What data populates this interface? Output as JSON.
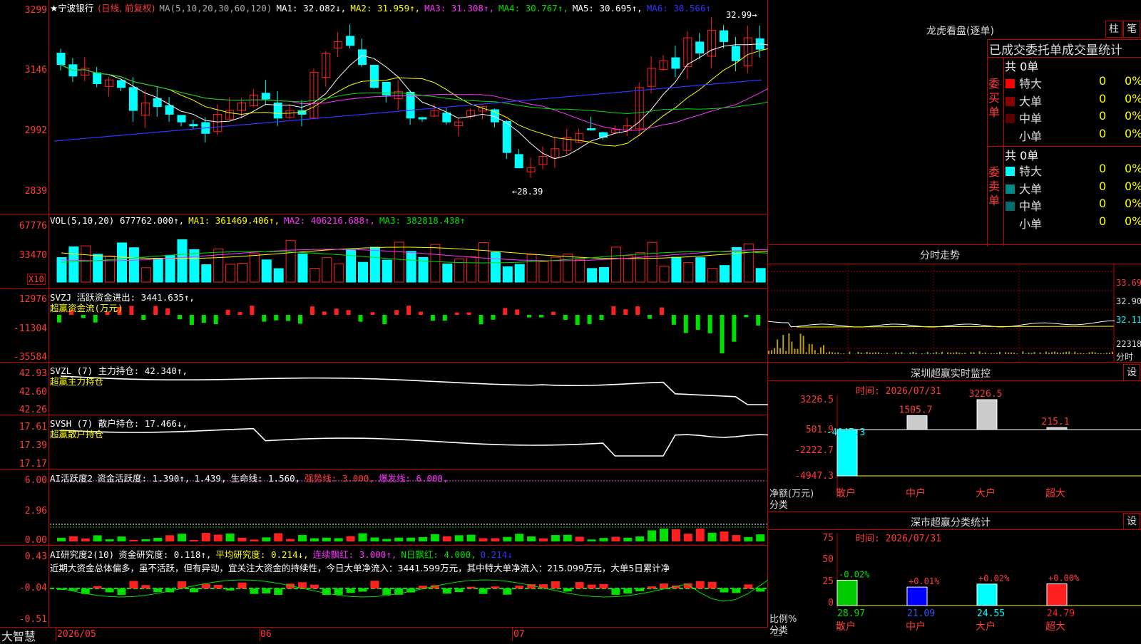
{
  "stock": {
    "name": "★宁波银行",
    "mode": "(日线, 前复权)",
    "ma_label": "MA(5,10,20,30,60,120)",
    "ma1": "MA1: 32.082↓,",
    "ma2": "MA2: 31.959↑,",
    "ma3": "MA3: 31.308↑,",
    "ma4": "MA4: 30.767↑,",
    "ma5": "MA5: 30.695↑,",
    "ma6": "MA6: 30.566↑",
    "price_axis": [
      "3299",
      "3146",
      "2992",
      "2839"
    ],
    "high_marker": "32.99→",
    "low_marker": "←28.39"
  },
  "vol": {
    "header": "VOL(5,10,20)  677762.000↑,",
    "ma1": "MA1: 361469.406↑,",
    "ma2": "MA2: 406216.688↑,",
    "ma3": "MA3: 382818.438↑",
    "axis": [
      "67776",
      "33470"
    ],
    "unit": "X10"
  },
  "svzj": {
    "header": "SVZJ  活跃资金进出: 3441.635↑,",
    "sub": "超赢资金流(万元)",
    "axis": [
      "12976",
      "-11304",
      "-35584"
    ]
  },
  "svzl": {
    "header": "SVZL (7) 主力持仓: 42.340↑,",
    "sub": "超赢主力持仓",
    "axis": [
      "42.93",
      "42.60",
      "42.26"
    ]
  },
  "svsh": {
    "header": "SVSH (7) 散户持仓: 17.466↓,",
    "sub": "超赢散户持仓",
    "axis": [
      "17.61",
      "17.39",
      "17.17"
    ]
  },
  "ai1": {
    "name": "AI活跃度2",
    "a": "资金活跃度: 1.390↑,",
    "b": "1.439,",
    "c": "生命线: 1.560,",
    "d": "强势线: 3.000,",
    "e": "爆发线: 6.000,",
    "axis": [
      "6.00",
      "2.96",
      "0.00"
    ]
  },
  "ai2": {
    "name": "AI研究度2(10)",
    "a": "资金研究度: 0.118↑,",
    "b": "平均研究度: 0.214↓,",
    "c": "连续飘红: 3.000↑,",
    "d": "N日飘红: 4.000,",
    "e": "0.214↓",
    "comment": "近期大资金总体偏多，虽不活跃，但有异动，宜关注大资金的持续性，今日大单净流入：3441.599万元，其中特大单净流入：215.099万元，大单5日累计净",
    "axis": [
      "0.43",
      "-0.04",
      "-0.51"
    ]
  },
  "dates": [
    "2026/05",
    "06",
    "07"
  ],
  "brand": "大智慧",
  "dragon": {
    "title": "龙虎看盘(逐单)",
    "btn1": "柱",
    "btn2": "笔",
    "heading": "已成交委托单成交量统计",
    "buy_label": "委买单",
    "sell_label": "委卖单",
    "buy_total": "共 0单",
    "sell_total": "共 0单",
    "buy_rows": [
      {
        "name": "特大",
        "n": "0",
        "pct": "0%",
        "color": "#ff0000"
      },
      {
        "name": "大单",
        "n": "0",
        "pct": "0%",
        "color": "#8a0000"
      },
      {
        "name": "中单",
        "n": "0",
        "pct": "0%",
        "color": "#5a0000"
      },
      {
        "name": "小单",
        "n": "0",
        "pct": "0%",
        "color": "#000000"
      }
    ],
    "sell_rows": [
      {
        "name": "特大",
        "n": "0",
        "pct": "0%",
        "color": "#00ffff"
      },
      {
        "name": "大单",
        "n": "0",
        "pct": "0%",
        "color": "#008b8b"
      },
      {
        "name": "中单",
        "n": "0",
        "pct": "0%",
        "color": "#006d6d"
      },
      {
        "name": "小单",
        "n": "0",
        "pct": "0%",
        "color": "#000000"
      }
    ]
  },
  "intraday": {
    "title": "分时走势",
    "axis": [
      "33.69",
      "32.90",
      "32.11",
      "22318"
    ],
    "unit": "分时"
  },
  "monitor": {
    "title": "深圳超赢实时监控",
    "btn": "设",
    "time": "时间: 2026/07/31",
    "axis": [
      "3226.5",
      "501.9",
      "-2222.7",
      "-4947.3"
    ],
    "xlabel1": "净额(万元)",
    "xlabel2": "分类",
    "categories": [
      "散户",
      "中户",
      "大户",
      "超大"
    ],
    "values": [
      -4947.3,
      1505.7,
      3226.5,
      215.1
    ],
    "value_labels": [
      "-4947.3",
      "1505.7",
      "3226.5",
      "215.1"
    ]
  },
  "classify": {
    "title": "深市超赢分类统计",
    "btn": "设",
    "time": "时间: 2026/07/31",
    "axis": [
      "75",
      "50",
      "25",
      "0"
    ],
    "xlabel1": "比例%",
    "xlabel2": "分类",
    "categories": [
      "散户",
      "中户",
      "大户",
      "超大"
    ],
    "values": [
      28.97,
      21.09,
      24.55,
      24.79
    ],
    "value_labels": [
      "28.97",
      "21.09",
      "24.55",
      "24.79"
    ],
    "changes": [
      "-0.02%",
      "+0.01%",
      "+0.02%",
      "+0.00%"
    ],
    "colors": [
      "#00cc00",
      "#0000ff",
      "#00ffff",
      "#ff2020"
    ]
  },
  "colors": {
    "up": "#ff2020",
    "down": "#00ffff",
    "frame": "#c00000",
    "ma1": "#ffffff",
    "ma2": "#ffff00",
    "ma3": "#ff33ff",
    "ma4": "#00dd00",
    "ma6": "#3333ff"
  }
}
